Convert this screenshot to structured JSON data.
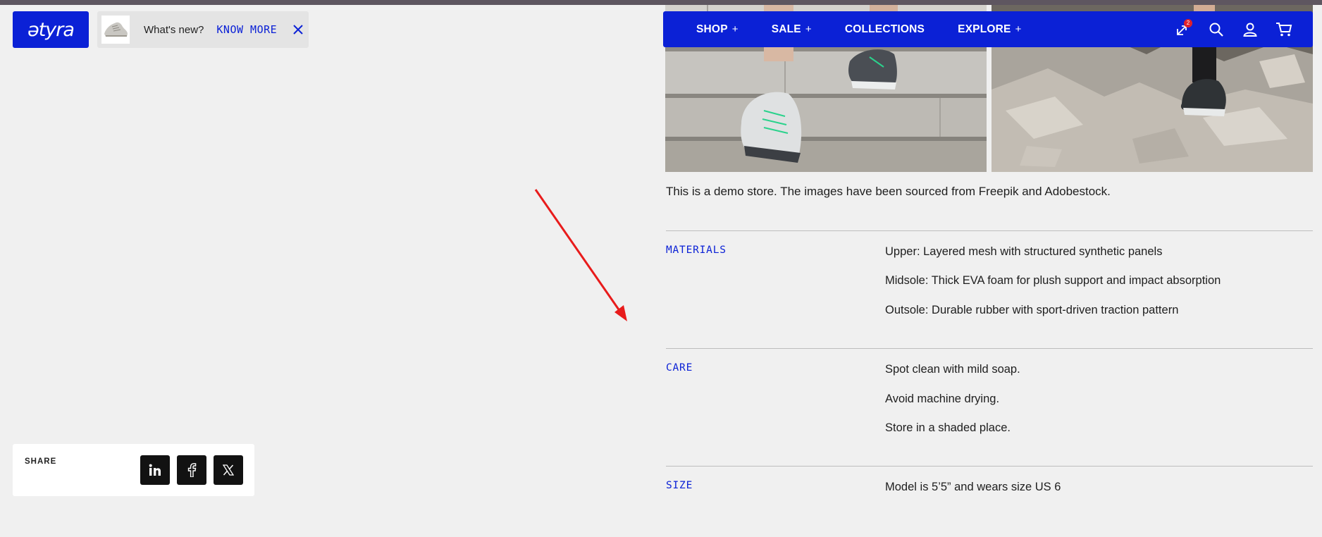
{
  "header": {
    "logo_text": "ətyra",
    "whats_new": "What's new?",
    "know_more": "KNOW MORE"
  },
  "nav": {
    "items": [
      {
        "label": "SHOP",
        "plus": "+"
      },
      {
        "label": "SALE",
        "plus": "+"
      },
      {
        "label": "COLLECTIONS",
        "plus": ""
      },
      {
        "label": "EXPLORE",
        "plus": "+"
      }
    ],
    "compare_count": "2",
    "icons": [
      "compare-icon",
      "search-icon",
      "account-icon",
      "cart-icon"
    ]
  },
  "product": {
    "demo_note": "This is a demo store. The images have been sourced from Freepik and Adobestock.",
    "materials_label": "MATERIALS",
    "materials": [
      "Upper: Layered mesh with structured synthetic panels",
      "Midsole: Thick EVA foam for plush support and impact absorption",
      "Outsole: Durable rubber with sport-driven traction pattern"
    ],
    "care_label": "CARE",
    "care": [
      "Spot clean with mild soap.",
      "Avoid machine drying.",
      "Store in a shaded place."
    ],
    "size_label": "SIZE",
    "size": [
      "Model is 5’5” and wears size US 6"
    ]
  },
  "share": {
    "label": "SHARE",
    "buttons": [
      "linkedin-icon",
      "facebook-icon",
      "x-icon"
    ]
  },
  "colors": {
    "brand_blue": "#0b21d6",
    "background": "#f0f0f0",
    "annotation_arrow": "#e81b1b"
  }
}
